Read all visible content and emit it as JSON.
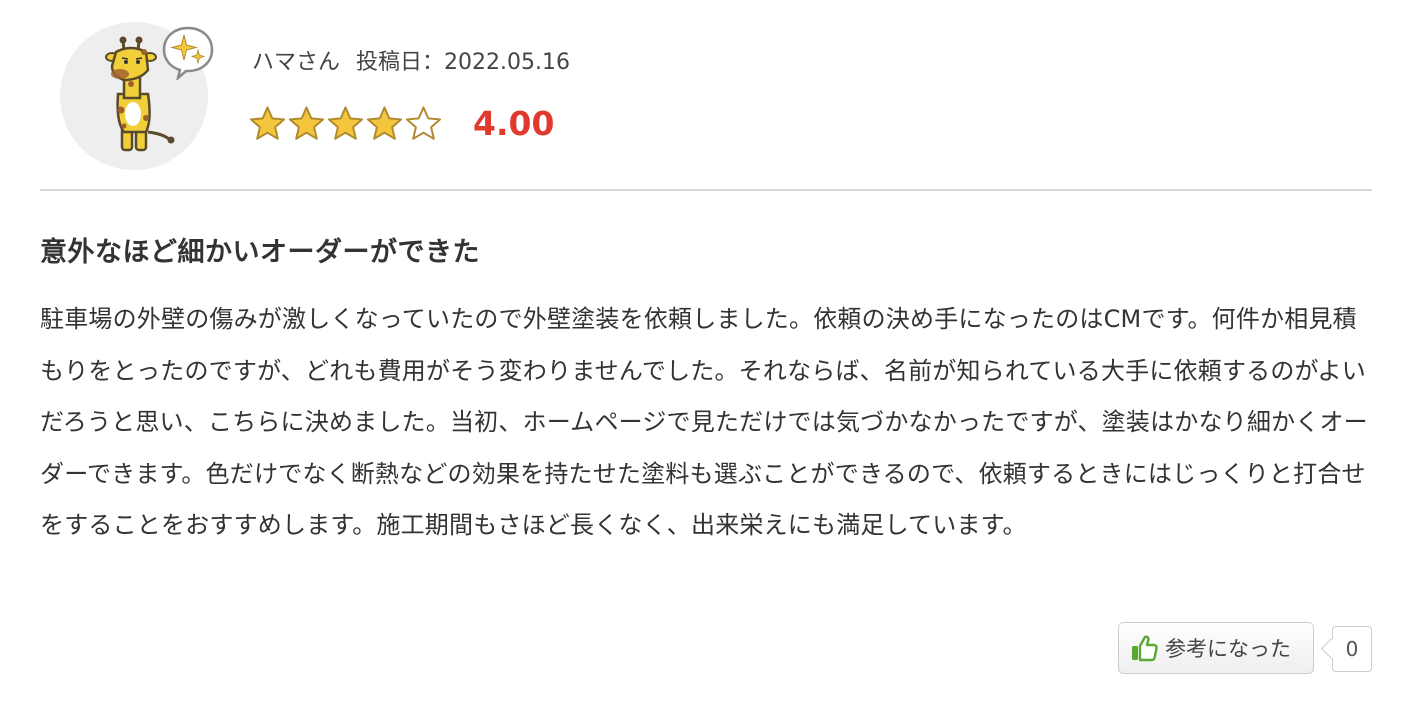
{
  "review": {
    "author": "ハマさん",
    "date_label": "投稿日：2022.05.16",
    "rating": {
      "value": 4,
      "max": 5,
      "score_text": "4.00"
    },
    "title": "意外なほど細かいオーダーができた",
    "body": "駐車場の外壁の傷みが激しくなっていたので外壁塗装を依頼しました。依頼の決め手になったのはCMです。何件か相見積もりをとったのですが、どれも費用がそう変わりませんでした。それならば、名前が知られている大手に依頼するのがよいだろうと思い、こちらに決めました。当初、ホームページで見ただけでは気づかなかったですが、塗装はかなり細かくオーダーできます。色だけでなく断熱などの効果を持たせた塗料も選ぶことができるので、依頼するときにはじっくりと打合せをすることをおすすめします。施工期間もさほど長くなく、出来栄えにも満足しています。"
  },
  "helpful": {
    "label": "参考になった",
    "count": "0"
  },
  "colors": {
    "score": "#e03a2e",
    "star_fill": "#f4c63d",
    "star_outline": "#b08a2e",
    "thumb": "#5aa832",
    "avatar_bg": "#eeeeee"
  },
  "icons": [
    "giraffe-avatar-icon",
    "sparkle-bubble-icon",
    "star-icon",
    "thumbs-up-icon"
  ]
}
